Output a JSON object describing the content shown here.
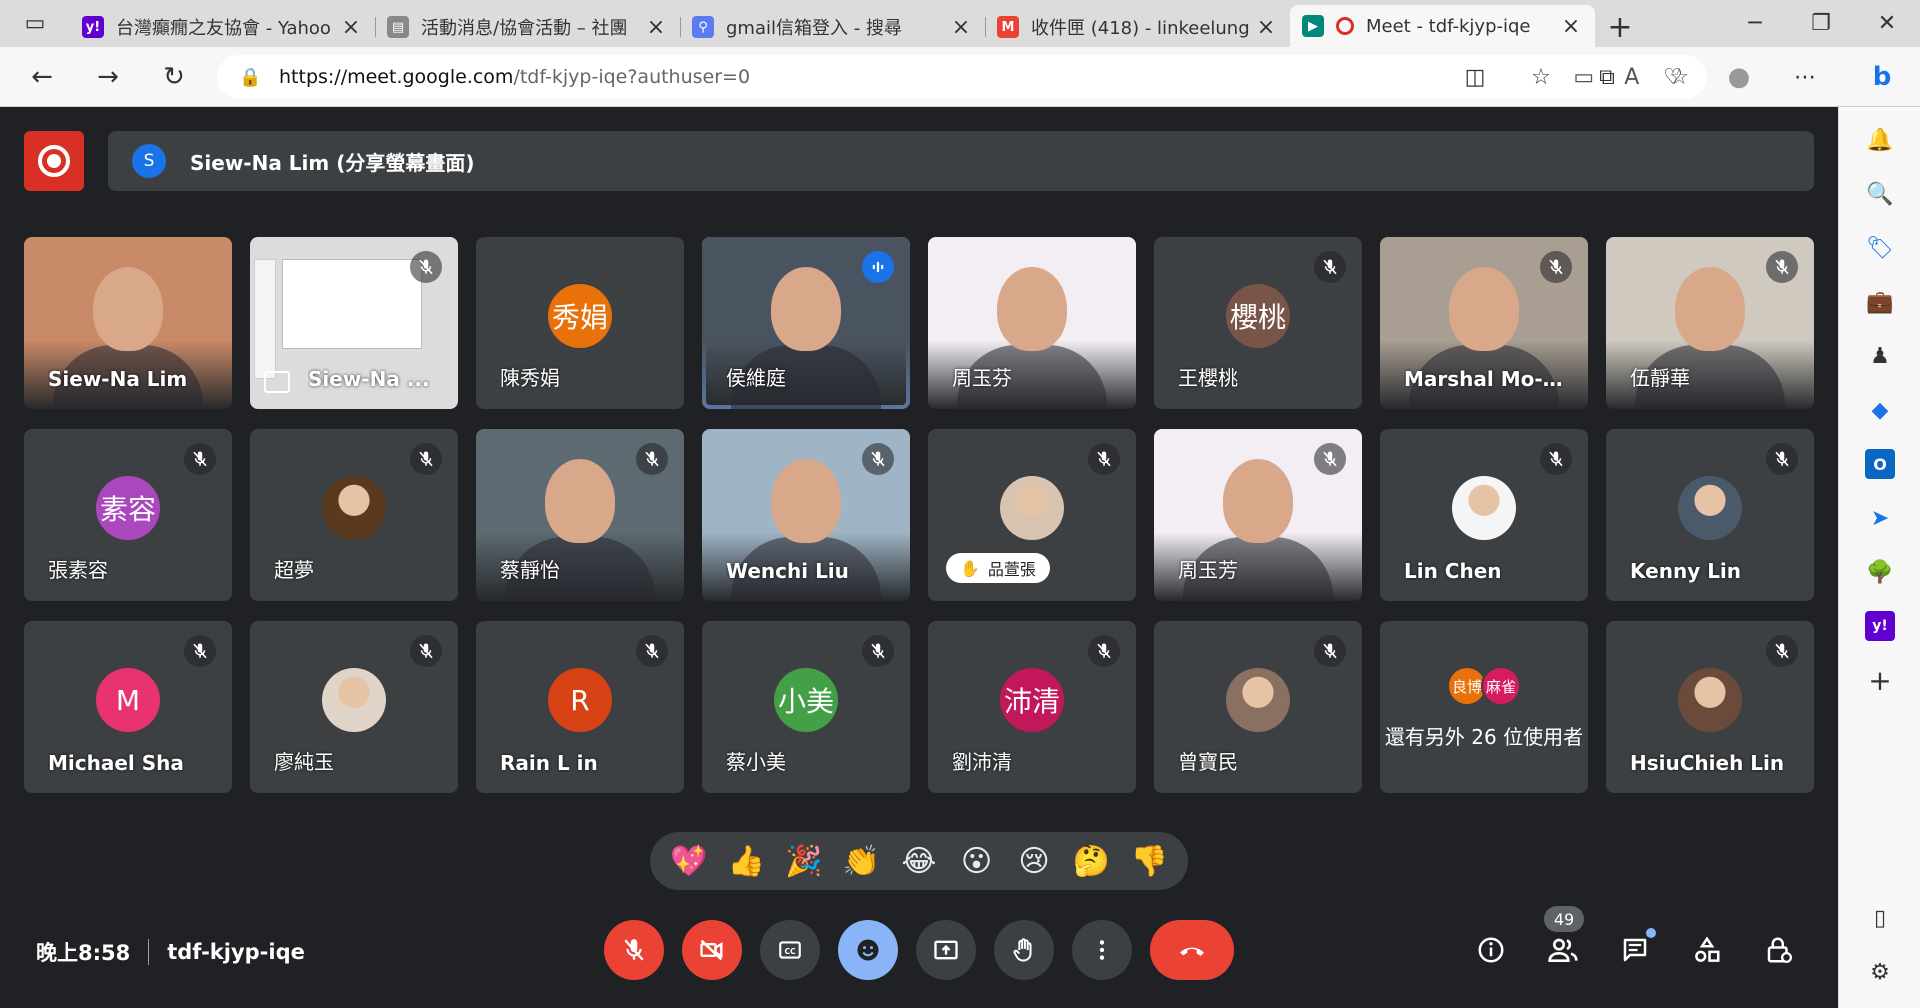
{
  "browser": {
    "tabs": [
      {
        "title": "台灣癲癇之友協會 - Yahoo",
        "favicon": "y!",
        "fav_color": "#6001d2",
        "active": false
      },
      {
        "title": "活動消息/協會活動 – 社團",
        "favicon": "doc",
        "fav_color": "#888888",
        "active": false
      },
      {
        "title": "gmail信箱登入 - 搜尋",
        "favicon": "search",
        "fav_color": "#5b7cf0",
        "active": false
      },
      {
        "title": "收件匣 (418) - linkeelung",
        "favicon": "M",
        "fav_color": "#ea4335",
        "active": false
      },
      {
        "title": "Meet - tdf-kjyp-iqe",
        "favicon": "meet",
        "fav_color": "#00897b",
        "active": true
      }
    ],
    "url_host": "https://meet.google.com",
    "url_path": "/tdf-kjyp-iqe?authuser=0"
  },
  "presenter": {
    "initial": "S",
    "text": "Siew-Na Lim (分享螢幕畫面)"
  },
  "participants": [
    {
      "name": "Siew-Na Lim",
      "type": "video",
      "bg": "#c98a67",
      "bold": true,
      "mic": "none"
    },
    {
      "name": "Siew-Na ...",
      "type": "screen",
      "bg": "#e8e8e8",
      "bold": true,
      "mic": "muted"
    },
    {
      "name": "陳秀娟",
      "type": "avatar",
      "avatar": "秀娟",
      "color": "#e8710a",
      "mic": "none"
    },
    {
      "name": "侯維庭",
      "type": "video",
      "bg": "#4a5460",
      "mic": "active",
      "speaking": true
    },
    {
      "name": "周玉芬",
      "type": "video",
      "bg": "#f2eef4",
      "mic": "none"
    },
    {
      "name": "王櫻桃",
      "type": "avatar",
      "avatar": "櫻桃",
      "color": "#795548",
      "mic": "muted"
    },
    {
      "name": "Marshal Mo-S...",
      "type": "video",
      "bg": "#a89e92",
      "bold": true,
      "mic": "muted"
    },
    {
      "name": "伍靜華",
      "type": "video",
      "bg": "#cfc9c0",
      "mic": "muted"
    },
    {
      "name": "張素容",
      "type": "avatar",
      "avatar": "素容",
      "color": "#ab47bc",
      "mic": "muted"
    },
    {
      "name": "超夢",
      "type": "photo",
      "photo_color": "#5a3a1e",
      "mic": "muted"
    },
    {
      "name": "蔡靜怡",
      "type": "video",
      "bg": "#5d6a72",
      "mic": "muted"
    },
    {
      "name": "Wenchi Liu",
      "type": "video",
      "bg": "#9fb4c4",
      "bold": true,
      "mic": "muted"
    },
    {
      "name": "品萱張",
      "type": "photo-hand",
      "photo_color": "#d8c4b0",
      "mic": "muted"
    },
    {
      "name": "周玉芳",
      "type": "video",
      "bg": "#f2eef4",
      "mic": "muted"
    },
    {
      "name": "Lin Chen",
      "type": "photo",
      "photo_color": "#f5f5f5",
      "bold": true,
      "mic": "muted"
    },
    {
      "name": "Kenny Lin",
      "type": "photo",
      "photo_color": "#4a5a6a",
      "bold": true,
      "mic": "muted"
    },
    {
      "name": "Michael Sha",
      "type": "avatar",
      "avatar": "M",
      "color": "#e8336e",
      "bold": true,
      "mic": "muted"
    },
    {
      "name": "廖純玉",
      "type": "photo",
      "photo_color": "#e0d4c8",
      "mic": "muted"
    },
    {
      "name": "Rain L in",
      "type": "avatar",
      "avatar": "R",
      "color": "#d84315",
      "bold": true,
      "mic": "muted"
    },
    {
      "name": "蔡小美",
      "type": "avatar",
      "avatar": "小美",
      "color": "#43a047",
      "mic": "muted"
    },
    {
      "name": "劉沛清",
      "type": "avatar",
      "avatar": "沛清",
      "color": "#c2185b",
      "mic": "muted"
    },
    {
      "name": "曾寶民",
      "type": "photo",
      "photo_color": "#8a7060",
      "mic": "muted"
    },
    {
      "name": "還有另外 26 位使用者",
      "type": "others",
      "others": [
        {
          "label": "良博",
          "color": "#e8710a"
        },
        {
          "label": "麻雀",
          "color": "#d81b60"
        }
      ],
      "mic": "none"
    },
    {
      "name": "HsiuChieh Lin",
      "type": "photo",
      "photo_color": "#6a4a3a",
      "bold": true,
      "mic": "muted"
    }
  ],
  "reactions": [
    "💖",
    "👍",
    "🎉",
    "👏",
    "😂",
    "😮",
    "😢",
    "🤔",
    "👎"
  ],
  "meeting": {
    "time": "晚上8:58",
    "code": "tdf-kjyp-iqe"
  },
  "people_count": "49"
}
